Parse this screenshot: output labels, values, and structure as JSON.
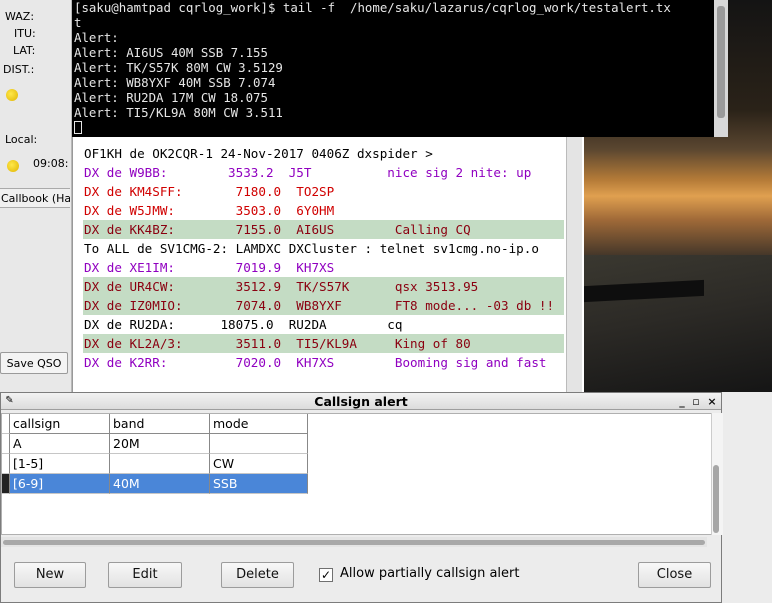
{
  "terminal": {
    "lines": [
      "[saku@hamtpad cqrlog_work]$ tail -f  /home/saku/lazarus/cqrlog_work/testalert.tx",
      "t",
      "Alert:",
      "Alert: AI6US 40M SSB 7.155",
      "Alert: TK/S57K 80M CW 3.5129",
      "Alert: WB8YXF 40M SSB 7.074",
      "Alert: RU2DA 17M CW 18.075",
      "Alert: TI5/KL9A 80M CW 3.511"
    ]
  },
  "left_panel": {
    "waz_label": "WAZ:",
    "itu_label": "ITU:",
    "lat_label": "LAT:",
    "dist_label": "DIST.:",
    "local_label": "Local:",
    "local_time": "09:08:",
    "callbook_tab": "Callbook (Ha",
    "save_qso": "Save QSO"
  },
  "cluster": {
    "lines": [
      {
        "text": "OF1KH de OK2CQR-1 24-Nov-2017 0406Z dxspider >",
        "color": "black",
        "hl": false
      },
      {
        "text": "DX de W9BB:        3533.2  J5T          nice sig 2 nite: up",
        "color": "purple",
        "hl": false
      },
      {
        "text": "DX de KM4SFF:       7180.0  TO2SP",
        "color": "red",
        "hl": false
      },
      {
        "text": "DX de W5JMW:        3503.0  6Y0HM",
        "color": "red",
        "hl": false
      },
      {
        "text": "DX de KK4BZ:        7155.0  AI6US        Calling CQ",
        "color": "maroon",
        "hl": true
      },
      {
        "text": "To ALL de SV1CMG-2: LAMDXC DXCluster : telnet sv1cmg.no-ip.o",
        "color": "black",
        "hl": false
      },
      {
        "text": "DX de XE1IM:        7019.9  KH7XS",
        "color": "purple",
        "hl": false
      },
      {
        "text": "DX de UR4CW:        3512.9  TK/S57K      qsx 3513.95",
        "color": "maroon",
        "hl": true
      },
      {
        "text": "DX de IZ0MIO:       7074.0  WB8YXF       FT8 mode... -03 db !!",
        "color": "maroon",
        "hl": true
      },
      {
        "text": "DX de RU2DA:      18075.0  RU2DA        cq",
        "color": "black",
        "hl": false
      },
      {
        "text": "DX de KL2A/3:       3511.0  TI5/KL9A     King of 80",
        "color": "maroon",
        "hl": true
      },
      {
        "text": "DX de K2RR:         7020.0  KH7XS        Booming sig and fast",
        "color": "purple",
        "hl": false
      }
    ]
  },
  "alert_window": {
    "title": "Callsign alert",
    "columns": [
      "callsign",
      "band",
      "mode"
    ],
    "rows": [
      {
        "callsign": "A",
        "band": "20M",
        "mode": "",
        "selected": false
      },
      {
        "callsign": "[1-5]",
        "band": "",
        "mode": "CW",
        "selected": false
      },
      {
        "callsign": "[6-9]",
        "band": "40M",
        "mode": "SSB",
        "selected": true
      }
    ],
    "buttons": {
      "new": "New",
      "edit": "Edit",
      "delete": "Delete",
      "close": "Close"
    },
    "allow_partial_label": "Allow partially callsign alert",
    "allow_partial_checked": true,
    "window_controls": [
      "_",
      "▫",
      "×"
    ]
  }
}
